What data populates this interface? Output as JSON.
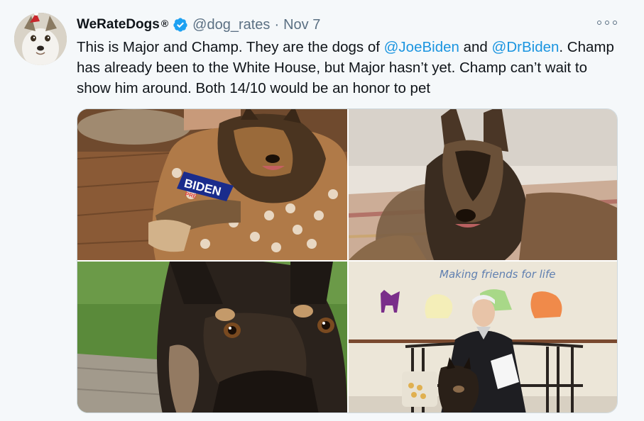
{
  "author": {
    "name": "WeRateDogs",
    "registered_mark": "®",
    "handle": "@dog_rates",
    "separator": "·",
    "date": "Nov 7",
    "verified": true
  },
  "tweet": {
    "text_part1": "This is Major and Champ. They are the dogs of ",
    "mention1": "@JoeBiden",
    "text_part2": " and ",
    "mention2": "@DrBiden",
    "text_part3": ". Champ has already been to the White House, but Major hasn’t yet. Champ can’t wait to show him around. Both 14/10 would be an honor to pet"
  },
  "media": {
    "photo4_caption": "Making friends for life",
    "photo1_sign_text": "BIDEN",
    "photo1_sign_subtext": "PRE"
  },
  "colors": {
    "link": "#1b95e0",
    "verified": "#1da1f2",
    "secondary_text": "#5b7083",
    "background": "#f5f8fa"
  },
  "icons": [
    "verified-badge-icon",
    "more-options-icon"
  ]
}
